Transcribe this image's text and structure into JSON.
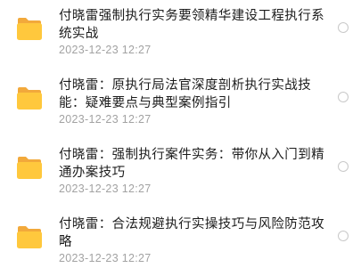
{
  "icons": {
    "folder": "folder-icon",
    "select": "radio-circle-icon"
  },
  "colors": {
    "folder_front": "#FFC83D",
    "folder_back": "#F2A93B",
    "title": "#1C1C1C",
    "date": "#A2A2A2",
    "radio_border": "#C8C8C8"
  },
  "items": [
    {
      "title": "付晓雷强制执行实务要领精华建设工程执行系统实战",
      "date": "2023-12-23 12:27",
      "selected": false
    },
    {
      "title": "付晓雷：原执行局法官深度剖析执行实战技能：疑难要点与典型案例指引",
      "date": "2023-12-23 12:27",
      "selected": false
    },
    {
      "title": "付晓雷：强制执行案件实务：带你从入门到精通办案技巧",
      "date": "2023-12-23 12:27",
      "selected": false
    },
    {
      "title": "付晓雷：合法规避执行实操技巧与风险防范攻略",
      "date": "2023-12-23 12:27",
      "selected": false
    }
  ]
}
